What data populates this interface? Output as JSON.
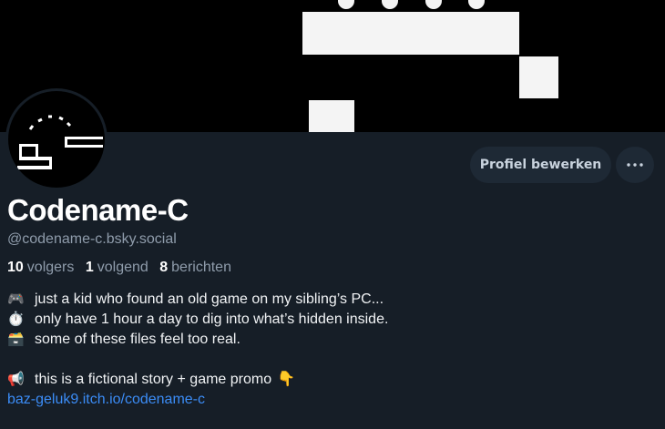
{
  "profile": {
    "display_name": "Codename-C",
    "handle": "@codename-c.bsky.social",
    "followers_count": "10",
    "followers_label": "volgers",
    "following_count": "1",
    "following_label": "volgend",
    "posts_count": "8",
    "posts_label": "berichten"
  },
  "actions": {
    "edit_label": "Profiel bewerken",
    "more_icon": "ellipsis-icon"
  },
  "bio": {
    "line1_emoji": "🎮",
    "line1_text": "just a kid who found an old game on my sibling’s PC...",
    "line2_emoji": "⏱️",
    "line2_text": "only have 1 hour a day to dig into what’s hidden inside.",
    "line3_emoji": "🗃️",
    "line3_text": "some of these files feel too real.",
    "line4_emoji": "📢",
    "line4_text": "this is a fictional story + game promo",
    "line4_trailing_emoji": "👇",
    "link_text": "baz-geluk9.itch.io/codename-c"
  },
  "colors": {
    "background": "#161e27",
    "button_bg": "#1e2935",
    "link": "#3b8cf6",
    "muted": "#8f9cab"
  }
}
